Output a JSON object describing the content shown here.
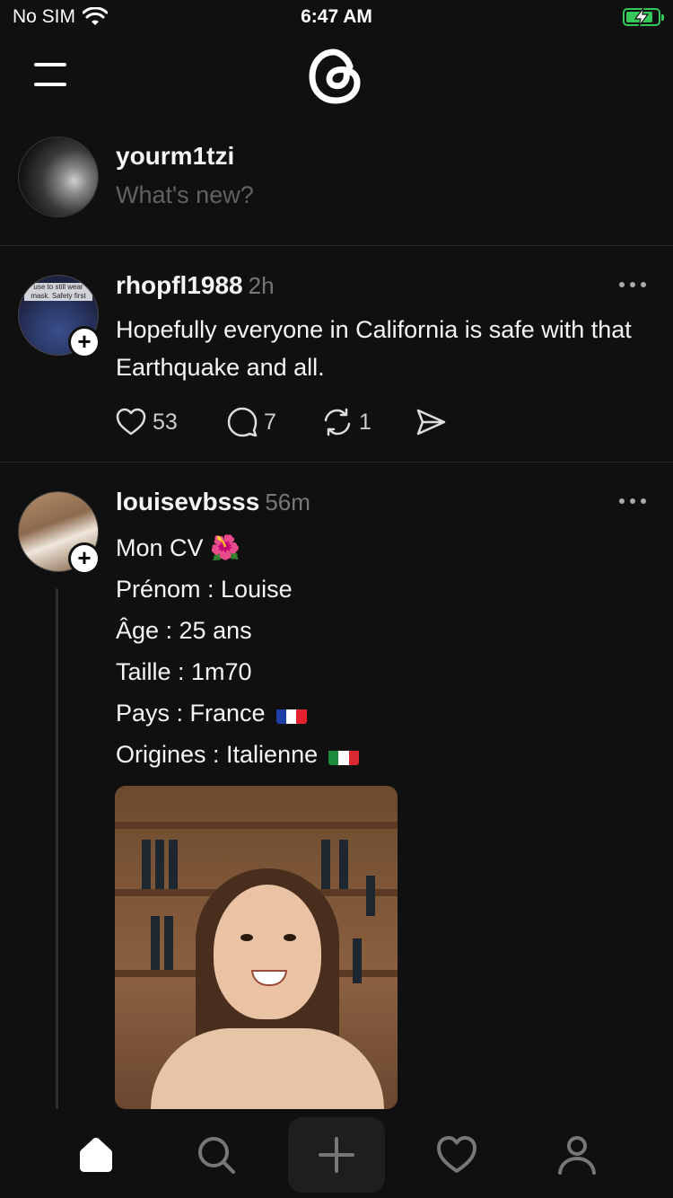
{
  "status_bar": {
    "carrier": "No SIM",
    "time": "6:47 AM",
    "battery_level": 0.85,
    "battery_color": "#34c759"
  },
  "nav": {
    "menu_icon": "hamburger-icon",
    "logo_icon": "threads-logo-icon"
  },
  "composer": {
    "username": "yourm1tzi",
    "placeholder": "What's new?"
  },
  "posts": [
    {
      "username": "rhopfl1988",
      "time": "2h",
      "avatar_caption": "use to still wear mask. Safety first",
      "text": "Hopefully everyone in California is safe with that Earthquake and all.",
      "likes": "53",
      "replies": "7",
      "reposts": "1"
    },
    {
      "username": "louisevbsss",
      "time": "56m",
      "lines": [
        "Mon CV 🌺",
        "Prénom : Louise",
        "Âge : 25 ans",
        "Taille : 1m70",
        "Pays : France",
        "Origines : Italienne"
      ]
    }
  ],
  "tab_bar": {
    "items": [
      "home-icon",
      "search-icon",
      "create-icon",
      "activity-icon",
      "profile-icon"
    ],
    "active": "home-icon"
  },
  "colors": {
    "background": "#101010",
    "text": "#f3f5f7",
    "muted": "#777777",
    "divider": "#2a2a2a"
  }
}
